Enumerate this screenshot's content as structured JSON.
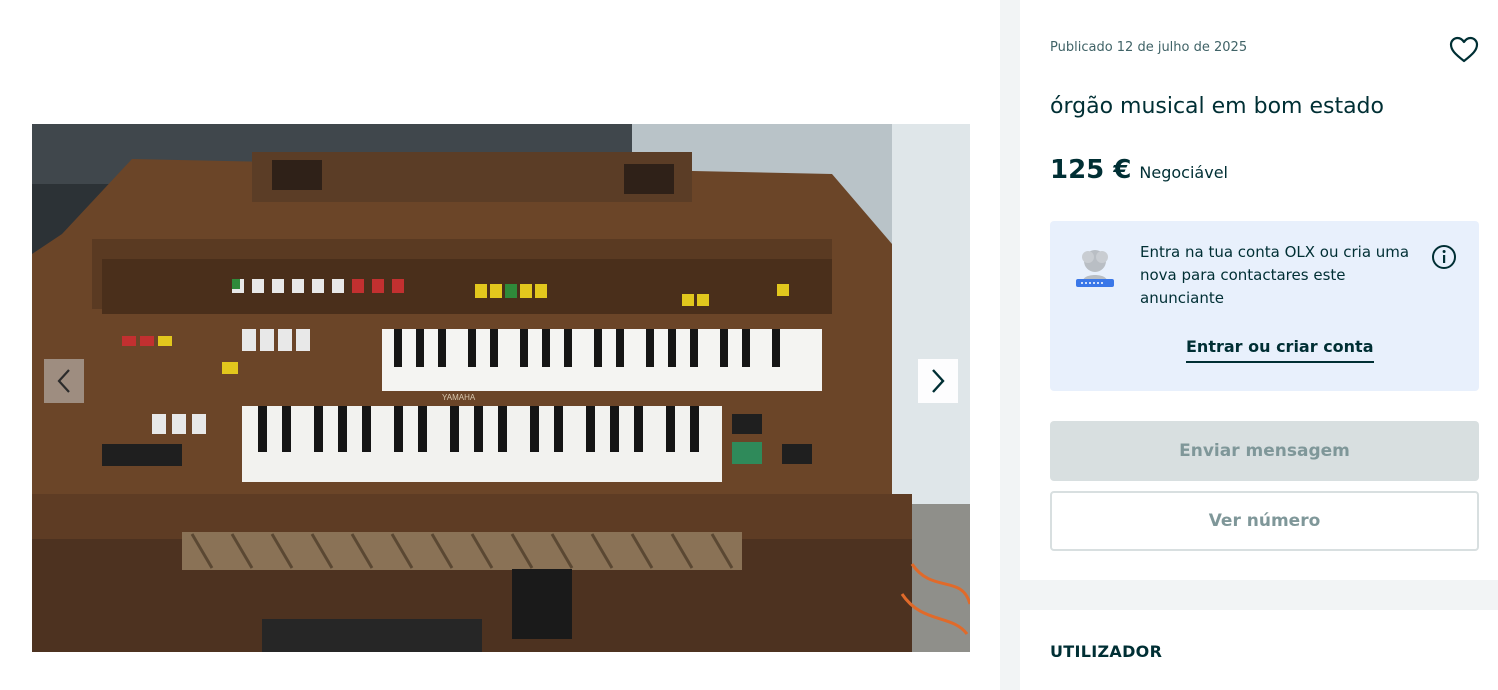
{
  "gallery": {
    "image_alt": "órgão musical em bom estado",
    "prev_icon": "chevron-left-icon",
    "next_icon": "chevron-right-icon",
    "brand_on_organ": "YAMAHA"
  },
  "ad": {
    "published": "Publicado 12 de julho de 2025",
    "favorite_icon": "heart-icon",
    "title": "órgão musical em bom estado",
    "price": "125 €",
    "negotiable": "Negociável"
  },
  "login_prompt": {
    "avatar_icon": "user-avatar-icon",
    "text": "Entra na tua conta OLX ou cria uma nova para contactares este anunciante",
    "info_icon": "info-icon",
    "link": "Entrar ou criar conta"
  },
  "actions": {
    "send_message": "Enviar mensagem",
    "view_number": "Ver número"
  },
  "user_section": {
    "heading": "UTILIZADOR"
  },
  "colors": {
    "text_primary": "#002f34",
    "text_muted": "#406367",
    "login_box_bg": "#e8f0fc",
    "disabled_bg": "#d8dfe0",
    "disabled_text": "#7f9799"
  }
}
